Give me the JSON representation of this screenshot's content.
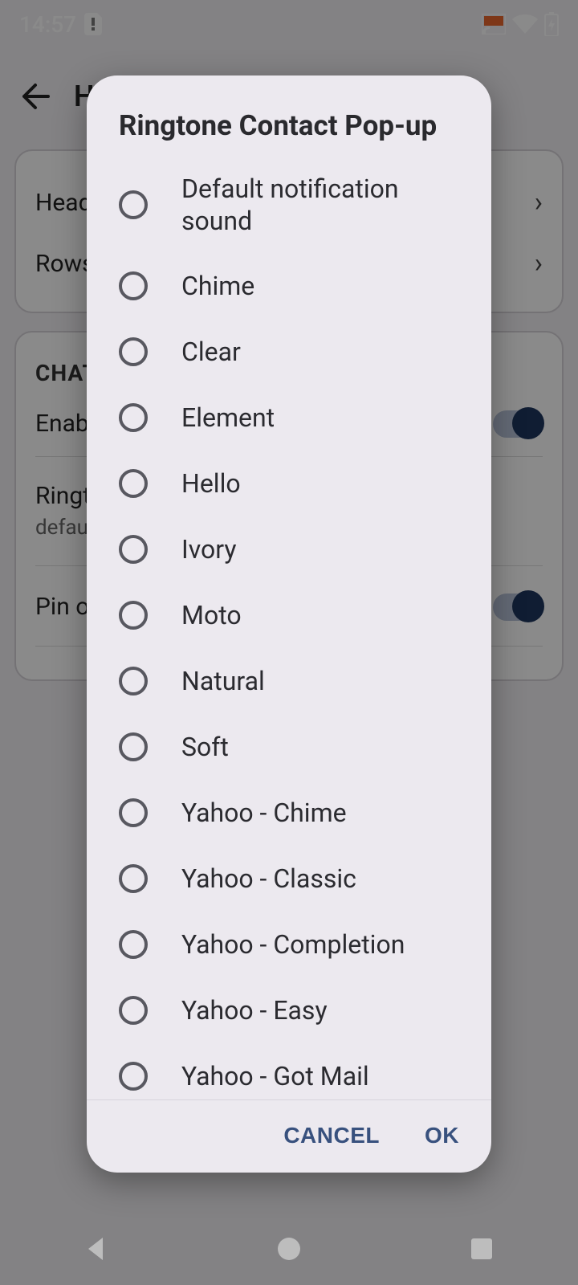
{
  "status": {
    "time": "14:57"
  },
  "app": {
    "title": "H",
    "card1": {
      "row1": "Head",
      "row2": "Rows"
    },
    "card2": {
      "section": "CHAT",
      "row1": "Enabl",
      "row2": "Ringto",
      "row2_sub": "default",
      "row3": "Pin ov"
    }
  },
  "dialog": {
    "title": "Ringtone Contact Pop-up",
    "options": [
      "Default notification sound",
      "Chime",
      "Clear",
      "Element",
      "Hello",
      "Ivory",
      "Moto",
      "Natural",
      "Soft",
      "Yahoo - Chime",
      "Yahoo - Classic",
      "Yahoo - Completion",
      "Yahoo - Easy",
      "Yahoo - Got Mail"
    ],
    "cancel": "CANCEL",
    "ok": "OK"
  }
}
